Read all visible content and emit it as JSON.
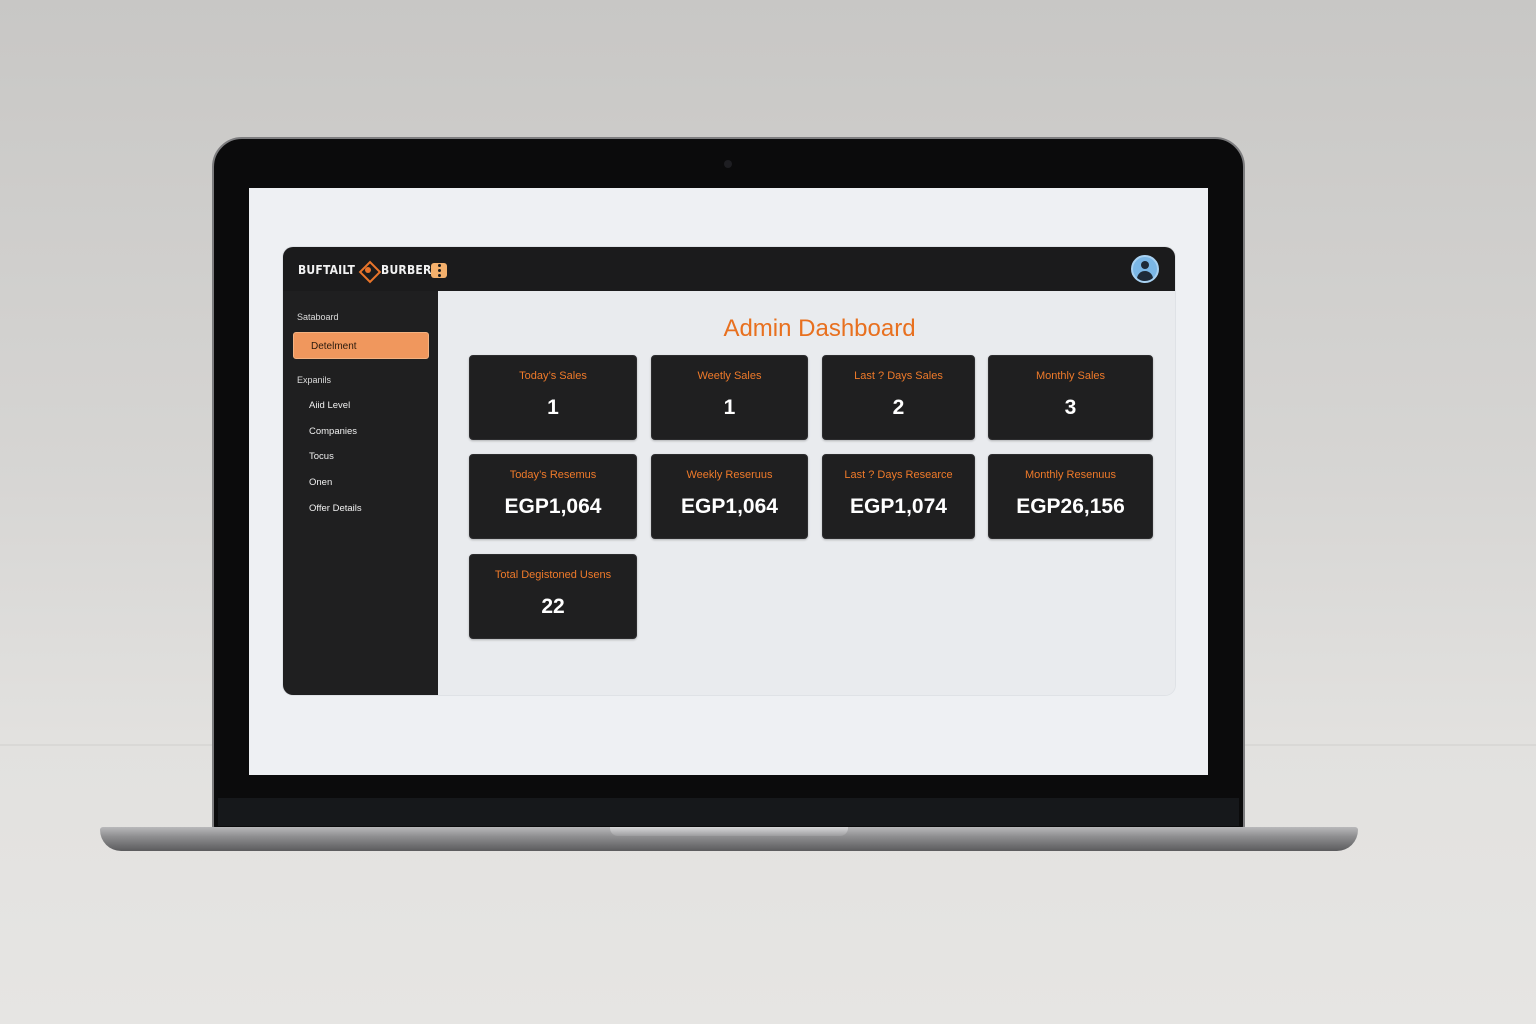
{
  "app": {
    "logo_left": "BUFTAILT",
    "logo_right": "BURBER"
  },
  "sidebar": {
    "section1": "Sataboard",
    "active_item": "Detelment",
    "section2": "Expanils",
    "items": [
      {
        "label": "Aiid Level"
      },
      {
        "label": "Companies"
      },
      {
        "label": "Tocus"
      },
      {
        "label": "Onen"
      },
      {
        "label": "Offer Details"
      }
    ]
  },
  "main": {
    "title": "Admin Dashboard",
    "cards": [
      {
        "label": "Today’s Sales",
        "value": "1"
      },
      {
        "label": "Weetly Sales",
        "value": "1"
      },
      {
        "label": "Last ? Days Sales",
        "value": "2"
      },
      {
        "label": "Monthly Sales",
        "value": "3"
      },
      {
        "label": "Today’s Resemus",
        "value": "EGP1,064"
      },
      {
        "label": "Weekly Reseruus",
        "value": "EGP1,064"
      },
      {
        "label": "Last  ? Days Researce",
        "value": "EGP1,074"
      },
      {
        "label": "Monthly Resenuus",
        "value": "EGP26,156"
      },
      {
        "label": "Total Degistoned Usens",
        "value": "22"
      }
    ]
  },
  "colors": {
    "accent": "#e8701f",
    "card_bg": "#1f1f20",
    "sidebar_bg": "#1f1f20",
    "active_item_bg": "#f0975d",
    "avatar_bg": "#7bb7e6"
  },
  "icons": {
    "logo": "diamond-logo-icon",
    "menu": "menu-dots-icon",
    "avatar": "user-avatar-icon"
  }
}
